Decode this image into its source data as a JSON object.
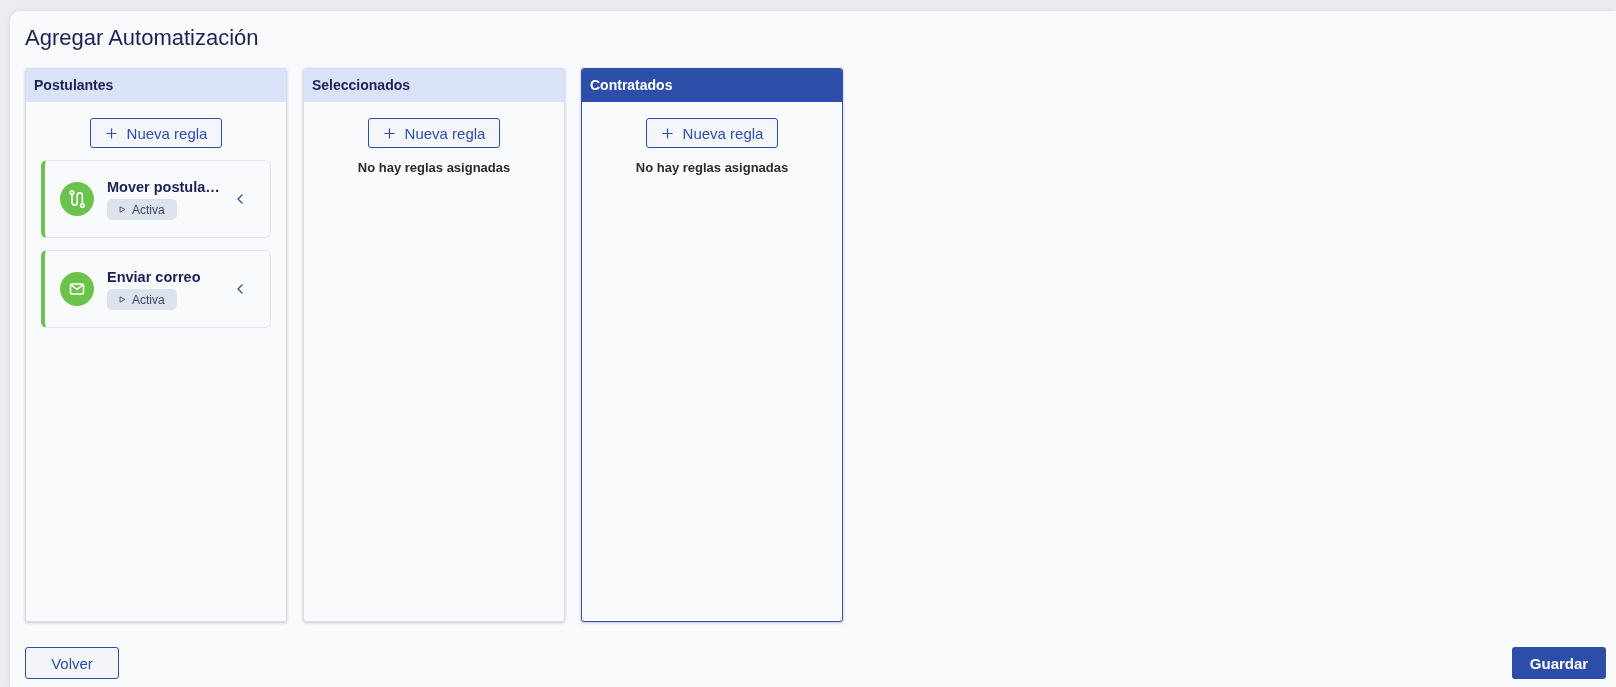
{
  "page": {
    "title": "Agregar Automatización"
  },
  "columns": [
    {
      "title": "Postulantes",
      "selected": false,
      "add_button": "Nueva regla",
      "rules": [
        {
          "kind": "move",
          "name": "Mover postula…",
          "status": "Activa"
        },
        {
          "kind": "email",
          "name": "Enviar correo",
          "status": "Activa"
        }
      ]
    },
    {
      "title": "Seleccionados",
      "selected": false,
      "add_button": "Nueva regla",
      "empty_message": "No hay reglas asignadas"
    },
    {
      "title": "Contratados",
      "selected": true,
      "add_button": "Nueva regla",
      "empty_message": "No hay reglas asignadas"
    }
  ],
  "footer": {
    "back_button": "Volver",
    "save_button": "Guardar"
  }
}
